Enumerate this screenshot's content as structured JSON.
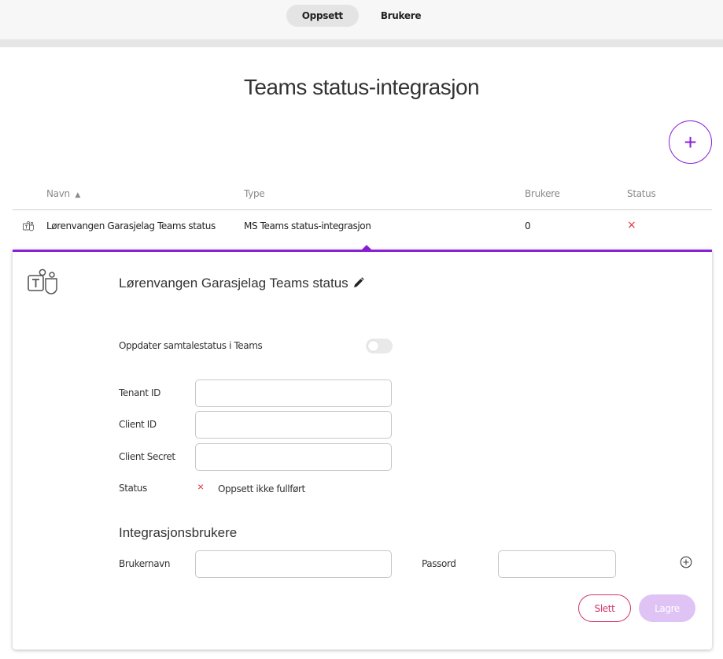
{
  "tabs": [
    {
      "label": "Oppsett",
      "active": true
    },
    {
      "label": "Brukere",
      "active": false
    }
  ],
  "page_title": "Teams status-integrasjon",
  "add_button_label": "+",
  "table": {
    "columns": [
      "Navn",
      "Type",
      "Brukere",
      "Status"
    ],
    "sort_indicator": "▲",
    "rows": [
      {
        "icon": "teams-icon",
        "name": "Lørenvangen Garasjelag Teams status",
        "type": "MS Teams status-integrasjon",
        "users": "0",
        "status": "×"
      }
    ]
  },
  "panel": {
    "title": "Lørenvangen Garasjelag Teams status",
    "toggle_label": "Oppdater samtalestatus i Teams",
    "toggle_on": false,
    "fields": {
      "tenant_id": {
        "label": "Tenant ID",
        "value": ""
      },
      "client_id": {
        "label": "Client ID",
        "value": ""
      },
      "client_secret": {
        "label": "Client Secret",
        "value": ""
      }
    },
    "status_label": "Status",
    "status_icon": "×",
    "status_text": "Oppsett ikke fullført",
    "section_title": "Integrasjonsbrukere",
    "username_label": "Brukernavn",
    "username_value": "",
    "password_label": "Passord",
    "password_value": "",
    "delete_label": "Slett",
    "save_label": "Lagre"
  },
  "colors": {
    "accent": "#8a1fd6",
    "error": "#e0303a",
    "delete": "#d6336c",
    "save_disabled": "#e0c3f5"
  }
}
